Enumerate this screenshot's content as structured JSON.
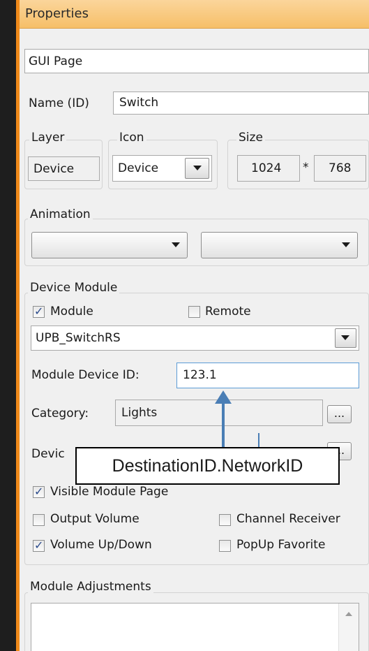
{
  "panel": {
    "title": "Properties",
    "object_type": "GUI Page",
    "name_label": "Name (ID)",
    "name_value": "Switch"
  },
  "layer": {
    "label": "Layer",
    "value": "Device"
  },
  "icon": {
    "label": "Icon",
    "value": "Device"
  },
  "size": {
    "label": "Size",
    "width": "1024",
    "separator": "*",
    "height": "768"
  },
  "animation": {
    "label": "Animation",
    "in_value": "",
    "out_value": ""
  },
  "device_module": {
    "label": "Device Module",
    "module_label": "Module",
    "module_checked": true,
    "remote_label": "Remote",
    "remote_checked": false,
    "module_select": "UPB_SwitchRS",
    "device_id_label": "Module Device ID:",
    "device_id_value": "123.1",
    "category_label": "Category:",
    "category_value": "Lights",
    "browse_label": "...",
    "device_row_label": "Devic",
    "visible_label": "Visible Module Page",
    "visible_checked": true,
    "output_volume_label": "Output Volume",
    "output_volume_checked": false,
    "channel_receiver_label": "Channel Receiver",
    "channel_receiver_checked": false,
    "volume_updown_label": "Volume Up/Down",
    "volume_updown_checked": true,
    "popup_favorite_label": "PopUp Favorite",
    "popup_favorite_checked": false
  },
  "module_adjustments": {
    "label": "Module Adjustments"
  },
  "annotation": {
    "text": "DestinationID.NetworkID",
    "arrow_color": "#4a7eb5"
  },
  "colors": {
    "title_bar": "#f6bf68",
    "frame_edge": "#f08a1a",
    "panel_bg": "#f0f0f0"
  }
}
